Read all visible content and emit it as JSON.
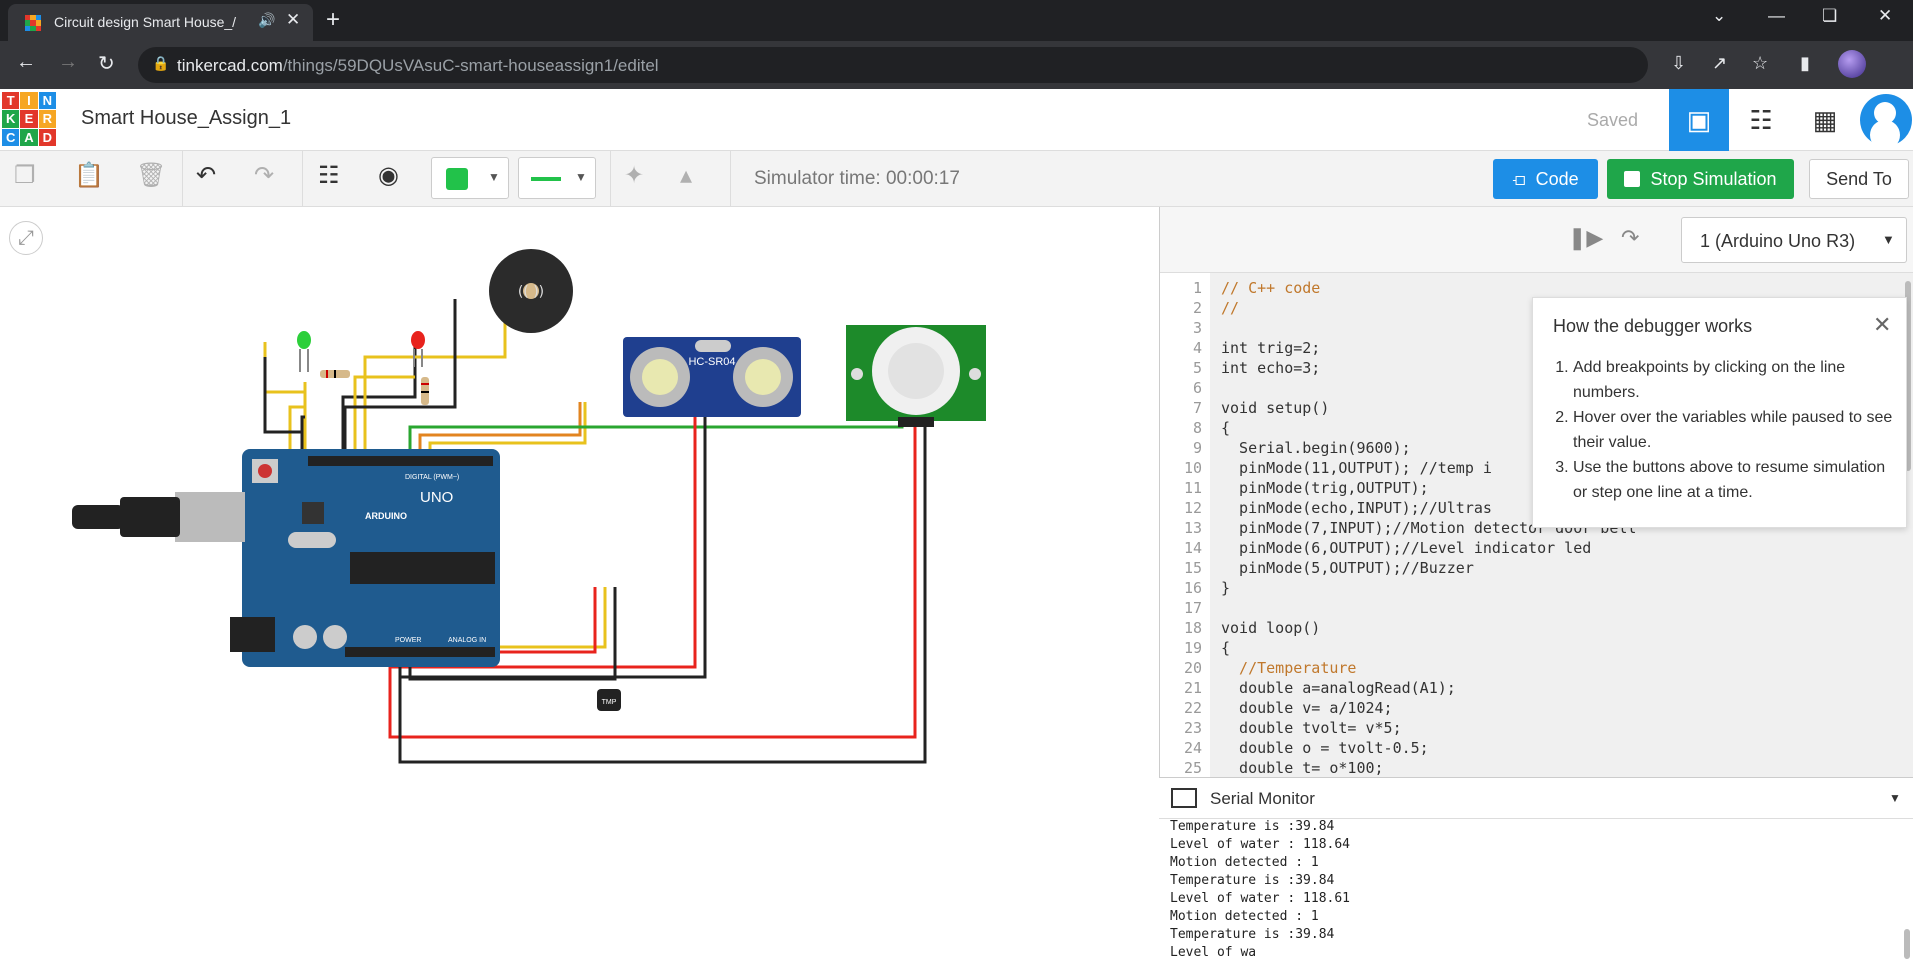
{
  "browser": {
    "tab_title": "Circuit design Smart House_/",
    "url_host": "tinkercad.com",
    "url_path": "/things/59DQUsVAsuC-smart-houseassign1/editel"
  },
  "app": {
    "project_title": "Smart House_Assign_1",
    "save_status": "Saved",
    "logo_letters": [
      "T",
      "I",
      "N",
      "K",
      "E",
      "R",
      "C",
      "A",
      "D"
    ]
  },
  "toolbar": {
    "simulator_time": "Simulator time: 00:00:17",
    "code_label": "Code",
    "stop_label": "Stop Simulation",
    "send_label": "Send To"
  },
  "debugger": {
    "device": "1 (Arduino Uno R3)",
    "tip_title": "How the debugger works",
    "tips": [
      "Add breakpoints by clicking on the line numbers.",
      "Hover over the variables while paused to see their value.",
      "Use the buttons above to resume simulation or step one line at a time."
    ]
  },
  "code_lines": [
    "// C++ code",
    "//",
    "",
    "int trig=2;",
    "int echo=3;",
    "",
    "void setup()",
    "{",
    "  Serial.begin(9600);",
    "  pinMode(11,OUTPUT); //temp i",
    "  pinMode(trig,OUTPUT);",
    "  pinMode(echo,INPUT);//Ultras",
    "  pinMode(7,INPUT);//Motion detector door bell",
    "  pinMode(6,OUTPUT);//Level indicator led",
    "  pinMode(5,OUTPUT);//Buzzer",
    "}",
    "",
    "void loop()",
    "{",
    "  //Temperature",
    "  double a=analogRead(A1);",
    "  double v= a/1024;",
    "  double tvolt= v*5;",
    "  double o = tvolt-0.5;",
    "  double t= o*100;"
  ],
  "serial": {
    "title": "Serial Monitor",
    "lines": [
      "Temperature is :39.84",
      "Level of water : 118.64",
      "Motion detected : 1",
      "Temperature is :39.84",
      "Level of water : 118.61",
      "Motion detected : 1",
      "Temperature is :39.84",
      "Level of wa"
    ]
  },
  "circuit": {
    "ultrasonic_label": "HC-SR04",
    "arduino_label": "UNO",
    "arduino_brand": "ARDUINO",
    "digital_label": "DIGITAL (PWM~)",
    "analog_label": "ANALOG IN",
    "power_label": "POWER",
    "temp_sensor_label": "TMP"
  }
}
